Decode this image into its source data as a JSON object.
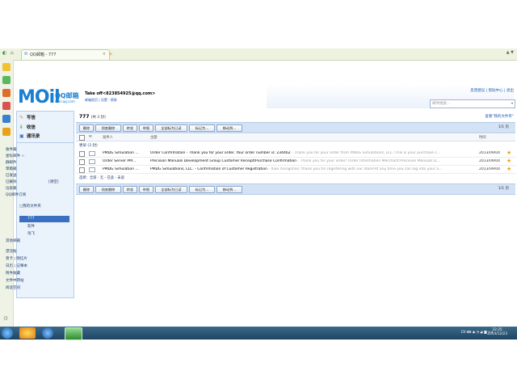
{
  "browser": {
    "tab_title": "QQ邮箱 - 777",
    "tab_close": "×",
    "new_tab": "+",
    "window_controls": "▲ ▼"
  },
  "header": {
    "logo_mail": "MOil",
    "logo_cn": "QQ邮箱",
    "logo_url": "mail.qq.com",
    "account": "Take off<823854925@qq.com>",
    "account_sub": "邮箱首页 | 设置 - 换肤",
    "top_links": "反馈建议 | 帮助中心 | 退出",
    "search_placeholder": "邮件搜索...",
    "search_dropdown": "▾"
  },
  "nav": {
    "write": "写信",
    "inbox": "收信",
    "contacts": "通讯录",
    "items": [
      "收件箱",
      "星标邮件 ☆",
      "群邮件",
      "草稿箱",
      "已发送",
      "已删除",
      "垃圾箱",
      "QQ邮件订阅"
    ],
    "deleted_action": "[清空]",
    "folders_header": "□我的文件夹",
    "folders": [
      "777",
      "软件",
      "淘飞"
    ],
    "other_mail": "其他邮箱",
    "bottom_items": [
      "漂流瓶",
      "贺卡 | 明信片",
      "日历 | 记事本",
      "附件收藏",
      "文件中转站",
      "阅读空间"
    ]
  },
  "main": {
    "title": "777",
    "count": "(共 3 封)",
    "view_all": "查看\"我的文件夹\"",
    "toolbar": [
      "删除",
      "彻底删除",
      "转发",
      "举报",
      "全部标为已读",
      "标记为...",
      "移动到..."
    ],
    "pager": "1/1 页",
    "columns": {
      "from": "发件人",
      "subject": "主题",
      "time": "时间"
    },
    "group_label": "更早 (3 封)",
    "rows": [
      {
        "from": "PMDG Simulation ...",
        "subject": "Order Confirmation - Thank you for your order. Your order number is: 234462",
        "preview": " - Thank you for your order from PMDG Simulations, LLC.!This is your purchase c...",
        "date": "2013/09/04",
        "star": "★"
      },
      {
        "from": "Order Server PM...",
        "subject": "Precision Manuals Development Group Customer Receipt/Purchase Confirmation",
        "preview": " - Thank you for your order! Order Information  Merchant:Precision Manuals D...",
        "date": "2013/09/04",
        "star": "★"
      },
      {
        "from": "PMDG Simulation ...",
        "subject": "PMDG Simulations, LLC. - Confirmation of Customer Registration",
        "preview": " - Xiao Xiongshan: thank you for registering with our store!At any time you can log into your a...",
        "date": "2013/09/04",
        "star": "★"
      }
    ],
    "select_bar": "选择：全部 - 无 - 已读 - 未读"
  },
  "taskbar": {
    "tray": "CH  ⌨  ◉  ◔  ◕  ◙  ♪  ◂",
    "time": "22:25",
    "date": "2014/12/23"
  }
}
